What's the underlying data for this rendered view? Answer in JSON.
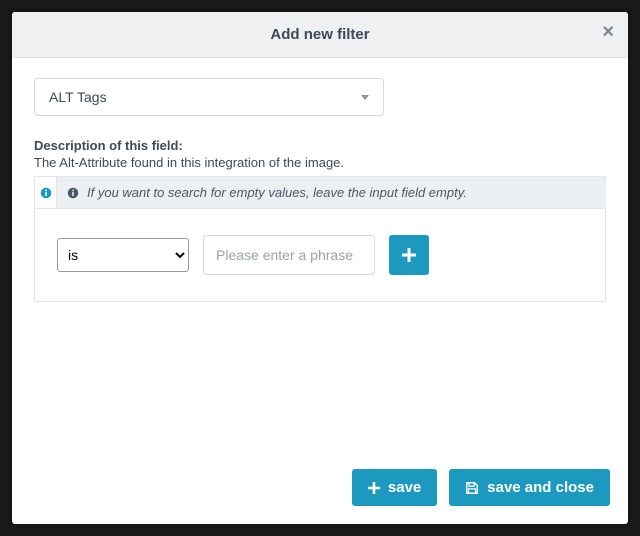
{
  "modal": {
    "title": "Add new filter"
  },
  "filter_field": {
    "selected": "ALT Tags",
    "description_label": "Description of this field:",
    "description_text": "The Alt-Attribute found in this integration of the image.",
    "hint": "If you want to search for empty values, leave the input field empty."
  },
  "condition": {
    "operator": "is",
    "phrase_placeholder": "Please enter a phrase",
    "phrase_value": ""
  },
  "footer": {
    "save_label": "save",
    "save_close_label": "save and close"
  },
  "colors": {
    "accent": "#1d99bf"
  }
}
